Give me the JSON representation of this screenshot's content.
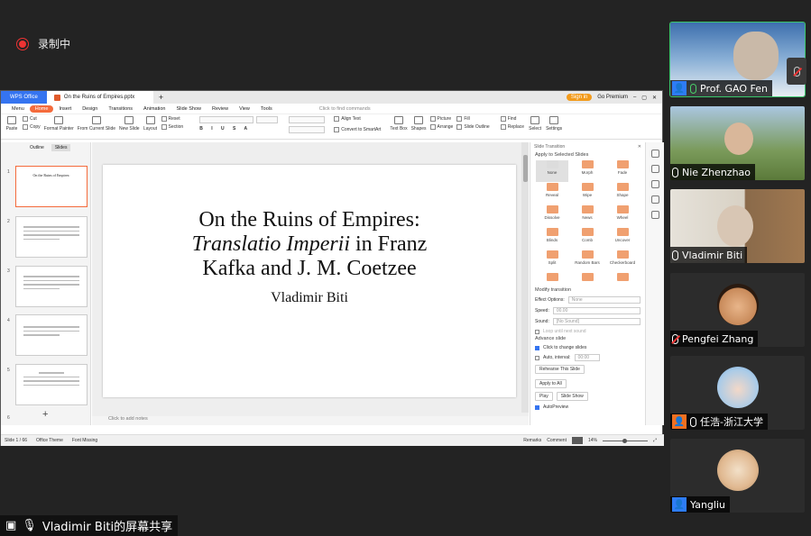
{
  "recording": {
    "label": "录制中"
  },
  "share_banner": {
    "label": "Vladimir Biti的屏幕共享"
  },
  "wps": {
    "app_tab": "WPS Office",
    "file_tab": "On the Ruins of Empires.pptx",
    "sign_in": "Sign in",
    "go_premium": "Go Premium",
    "menu": [
      "Menu",
      "Home",
      "Insert",
      "Design",
      "Transitions",
      "Animation",
      "Slide Show",
      "Review",
      "View",
      "Tools"
    ],
    "find": "Click to find commands",
    "ribbon": {
      "paste": "Paste",
      "cut": "Cut",
      "copy": "Copy",
      "format_painter": "Format Painter",
      "from_current": "From Current Slide",
      "new_slide": "New Slide",
      "layout": "Layout",
      "reset": "Reset",
      "section": "Section",
      "align_text": "Align Text",
      "convert": "Convert to SmartArt",
      "text_box": "Text Box",
      "shapes": "Shapes",
      "picture": "Picture",
      "arrange": "Arrange",
      "fill": "Fill",
      "slide_outline": "Slide Outline",
      "find_label": "Find",
      "replace": "Replace",
      "select": "Select",
      "settings": "Settings"
    },
    "left_tabs": [
      "Outline",
      "Slides"
    ],
    "thumb_nums": [
      "1",
      "2",
      "3",
      "4",
      "5",
      "6"
    ],
    "slide": {
      "line1": "On the Ruins of Empires:",
      "line2_em": "Translatio Imperii",
      "line2_rest": " in Franz",
      "line3": "Kafka and J. M. Coetzee",
      "author": "Vladimir Biti"
    },
    "notes": "Click to add notes",
    "transition_panel": {
      "header": "Slide Transition",
      "apply_selected": "Apply to Selected Slides",
      "effects": [
        "None",
        "Morph",
        "Fade",
        "Reveal",
        "Wipe",
        "Shape",
        "Dissolve",
        "News",
        "Wheel",
        "Blinds",
        "Comb",
        "Uncover",
        "Split",
        "Random Bars",
        "Checkerboard",
        "",
        "",
        ""
      ],
      "modify": "Modify transition",
      "effect_options": "Effect Options:",
      "effect_value": "None",
      "speed": "Speed:",
      "speed_value": "00.00",
      "sound": "Sound:",
      "sound_value": "[No Sound]",
      "loop": "Loop until next sound",
      "advance": "Advance slide",
      "on_click": "Click to change slides",
      "auto": "Auto, interval:",
      "auto_value": "00:00",
      "rehearse": "Rehearse This Slide",
      "apply_all": "Apply to All",
      "play": "Play",
      "slide_show": "Slide Show",
      "autopreview": "AutoPreview"
    },
    "status": {
      "slide_count": "Slide 1 / 66",
      "theme": "Office Theme",
      "font_missing": "Font Missing",
      "remarks": "Remarks",
      "comment": "Comment",
      "zoom": "14%"
    }
  },
  "participants": [
    {
      "name": "Prof. GAO Fen",
      "icon": "user-icon",
      "mic": "active"
    },
    {
      "name": "Nie Zhenzhao",
      "icon": "",
      "mic": "on"
    },
    {
      "name": "Vladimir Biti",
      "icon": "",
      "mic": "on"
    },
    {
      "name": "Pengfei Zhang",
      "icon": "",
      "mic": "muted"
    },
    {
      "name": "任浩-浙江大学",
      "icon": "user-icon",
      "mic": "on"
    },
    {
      "name": "Yangliu",
      "icon": "user-icon",
      "mic": "none"
    }
  ]
}
